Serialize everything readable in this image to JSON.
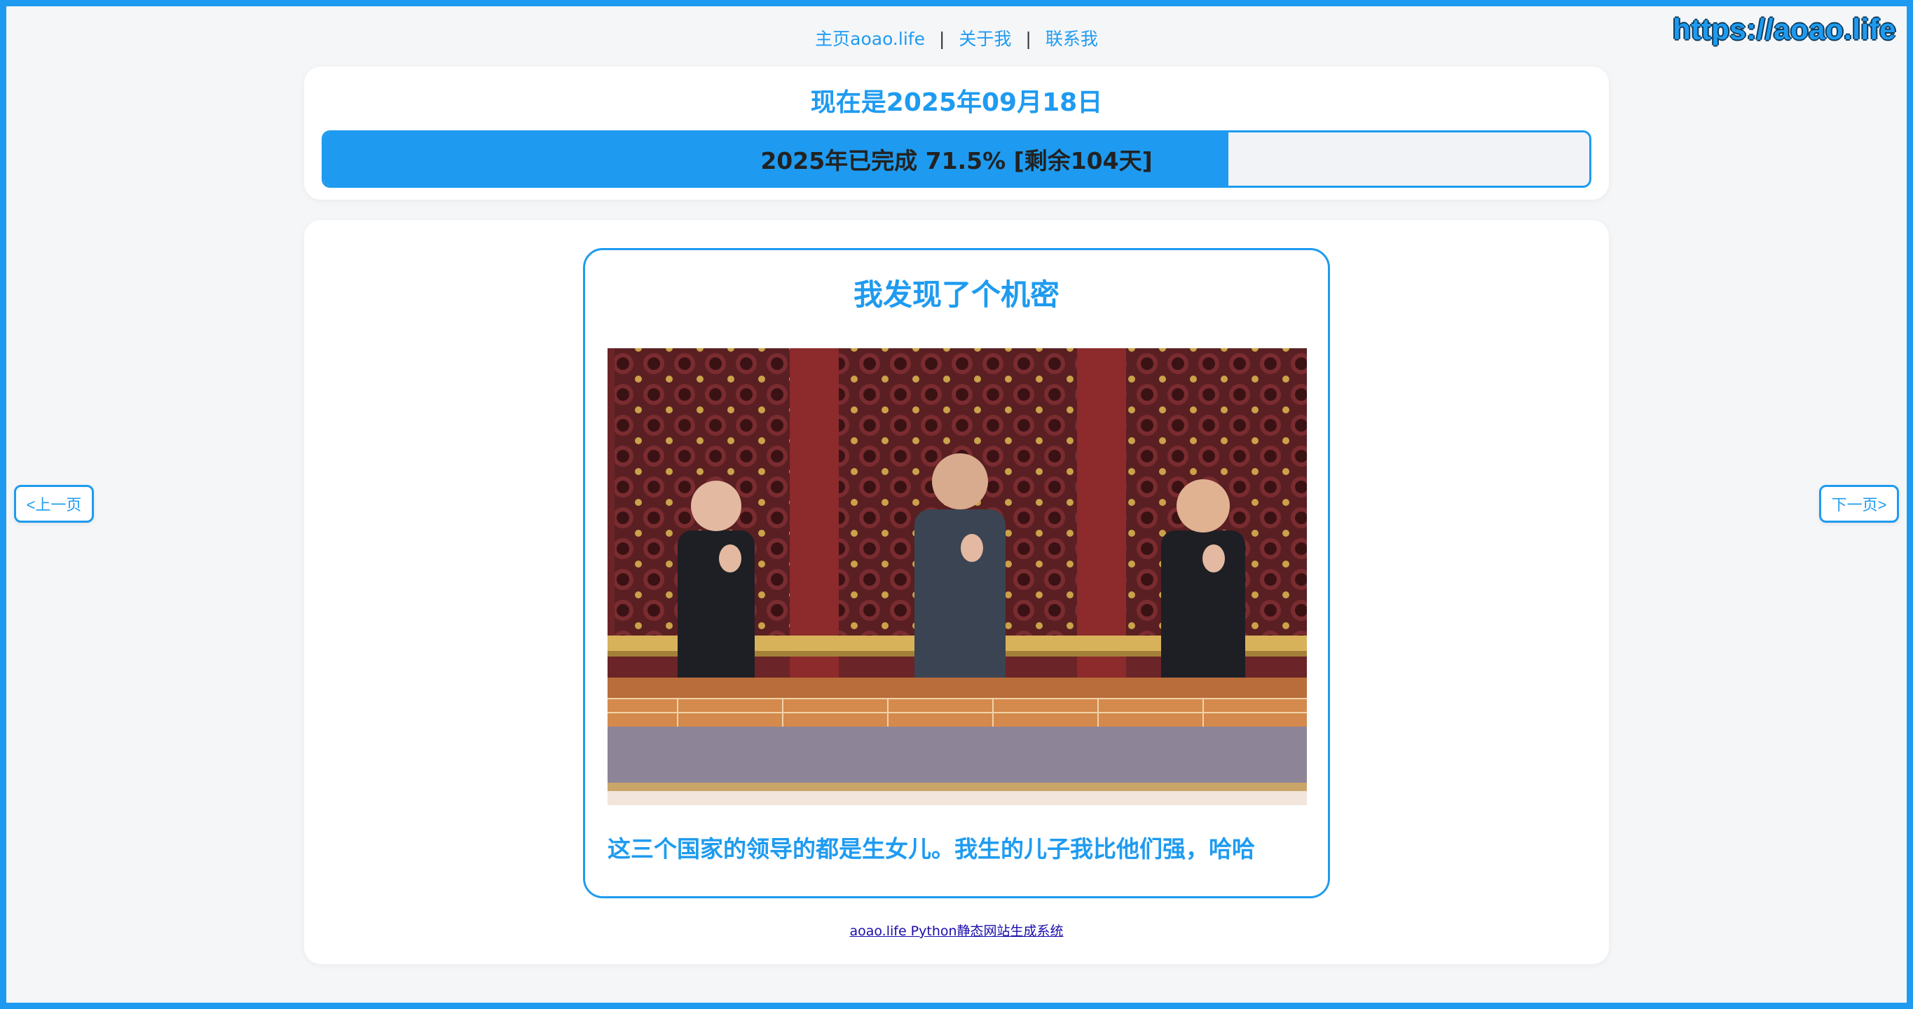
{
  "site_url": "https://aoao.life",
  "nav": {
    "home": "主页aoao.life",
    "about": "关于我",
    "contact": "联系我",
    "separator": "|"
  },
  "date_card": {
    "title": "现在是2025年09月18日",
    "progress_text": "2025年已完成 71.5% [剩余104天]",
    "progress_fraction": 0.715
  },
  "post": {
    "title": "我发现了个机密",
    "image_icon": "photo-image",
    "caption": "这三个国家的领导的都是生女儿。我生的儿子我比他们强，哈哈"
  },
  "footer": {
    "link_text": "aoao.life Python静态网站生成系统"
  },
  "pager": {
    "prev": "<上一页",
    "next": "下一页>"
  },
  "colors": {
    "accent": "#1e9bf0",
    "background": "#f5f6f8",
    "card": "#ffffff"
  }
}
